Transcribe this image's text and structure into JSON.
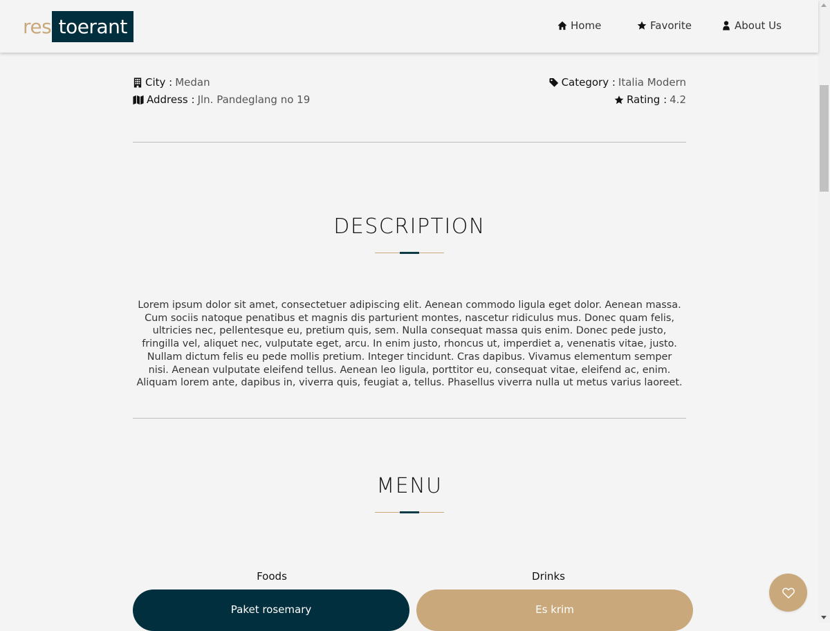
{
  "brand": {
    "prefix": "res",
    "suffix": "toerant"
  },
  "nav": [
    {
      "label": "Home",
      "icon": "home-icon"
    },
    {
      "label": "Favorite",
      "icon": "star-icon"
    },
    {
      "label": "About Us",
      "icon": "user-icon"
    }
  ],
  "info": {
    "city_label": "City :",
    "city": "Medan",
    "address_label": "Address :",
    "address": "Jln. Pandeglang no 19",
    "category_label": "Category :",
    "category": "Italia Modern",
    "rating_label": "Rating :",
    "rating": "4.2"
  },
  "description": {
    "title": "DESCRIPTION",
    "text": "Lorem ipsum dolor sit amet, consectetuer adipiscing elit. Aenean commodo ligula eget dolor. Aenean massa. Cum sociis natoque penatibus et magnis dis parturient montes, nascetur ridiculus mus. Donec quam felis, ultricies nec, pellentesque eu, pretium quis, sem. Nulla consequat massa quis enim. Donec pede justo, fringilla vel, aliquet nec, vulputate eget, arcu. In enim justo, rhoncus ut, imperdiet a, venenatis vitae, justo. Nullam dictum felis eu pede mollis pretium. Integer tincidunt. Cras dapibus. Vivamus elementum semper nisi. Aenean vulputate eleifend tellus. Aenean leo ligula, porttitor eu, consequat vitae, eleifend ac, enim. Aliquam lorem ante, dapibus in, viverra quis, feugiat a, tellus. Phasellus viverra nulla ut metus varius laoreet."
  },
  "menu": {
    "title": "MENU",
    "foods_label": "Foods",
    "drinks_label": "Drinks",
    "foods": [
      "Paket rosemary"
    ],
    "drinks": [
      "Es krim"
    ]
  },
  "colors": {
    "primary": "#022f3d",
    "accent": "#c9a97c",
    "background": "#f4f4f4"
  }
}
